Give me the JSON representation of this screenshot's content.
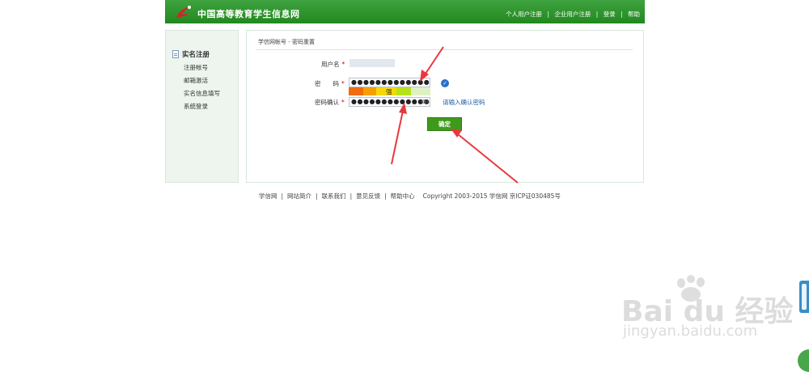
{
  "header": {
    "site_title": "中国高等教育学生信息网",
    "nav": [
      "个人用户注册",
      "企业用户注册",
      "登录",
      "帮助"
    ],
    "nav_separator": "|"
  },
  "sidebar": {
    "heading": "实名注册",
    "items": [
      "注册帐号",
      "邮箱激活",
      "实名信息填写",
      "系统登录"
    ]
  },
  "form": {
    "breadcrumb": "学信网帐号 - 密码重置",
    "username_label": "用户名",
    "password_label": "密　　码",
    "confirm_label": "密码确认",
    "required_mark": "*",
    "password_value": "●●●●●●●●●●●●●●",
    "confirm_value": "●●●●●●●●●●●●●",
    "strength_text": "强",
    "confirm_hint": "请输入确认密码",
    "submit_label": "确定"
  },
  "footer": {
    "links": [
      "学信网",
      "网站简介",
      "联系我们",
      "意见反馈",
      "帮助中心"
    ],
    "separator": "|",
    "copyright": "Copyright 2003-2015 学信网 京ICP证030485号"
  },
  "watermark": {
    "brand": "Bai du 经验",
    "url": "jingyan.baidu.com"
  },
  "colors": {
    "header_green": "#22881f",
    "button_green": "#3f9a1c",
    "link_blue": "#1f5ea8",
    "check_blue": "#2a6fc9",
    "arrow_red": "#e8383d",
    "required_red": "#dd0000"
  },
  "strength_meter": {
    "segments": [
      "#f26b0f",
      "#f5a000",
      "#f6d80a",
      "#b6e21a",
      "#dff1c2"
    ]
  }
}
